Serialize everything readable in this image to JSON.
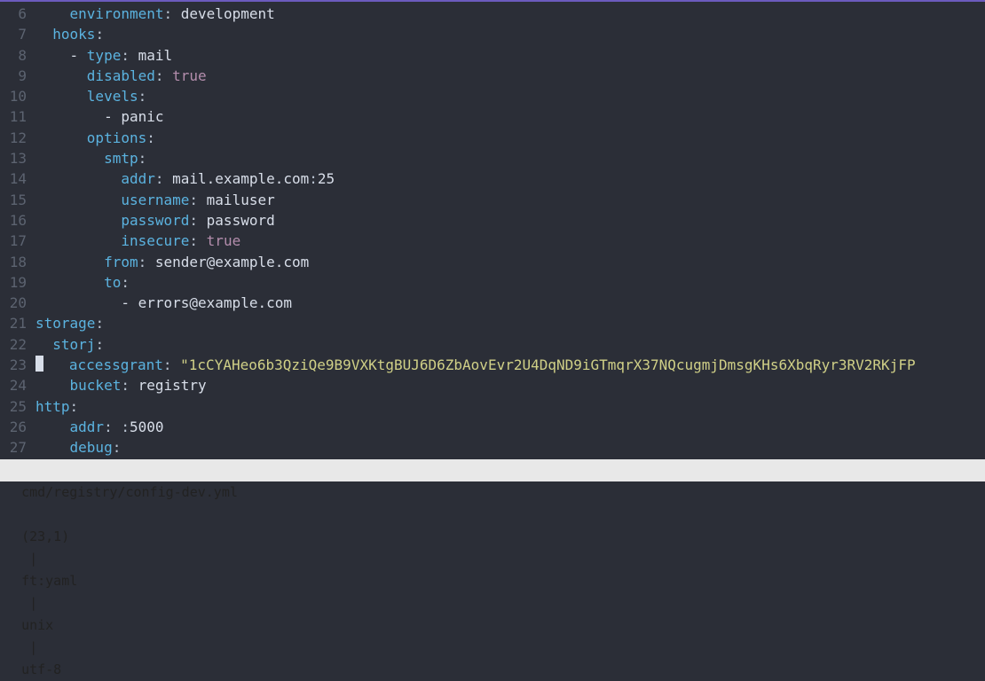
{
  "status": {
    "file": "cmd/registry/config-dev.yml",
    "cursor": "(23,1)",
    "ft": "ft:yaml",
    "nl": "unix",
    "enc": "utf-8",
    "sep": " | "
  },
  "gutter_start": 6,
  "gutter_end": 27,
  "lines": [
    {
      "parts": [
        {
          "t": "    ",
          "c": "lead"
        },
        {
          "t": "environment",
          "c": "blue"
        },
        {
          "t": ":",
          "c": "colon"
        },
        {
          "t": " development",
          "c": "word"
        }
      ]
    },
    {
      "parts": [
        {
          "t": "  ",
          "c": "lead"
        },
        {
          "t": "hooks",
          "c": "blue"
        },
        {
          "t": ":",
          "c": "colon"
        }
      ]
    },
    {
      "parts": [
        {
          "t": "    - ",
          "c": "word"
        },
        {
          "t": "type",
          "c": "blue"
        },
        {
          "t": ":",
          "c": "colon"
        },
        {
          "t": " mail",
          "c": "word"
        }
      ]
    },
    {
      "parts": [
        {
          "t": "      ",
          "c": "lead"
        },
        {
          "t": "disabled",
          "c": "blue"
        },
        {
          "t": ":",
          "c": "colon"
        },
        {
          "t": " ",
          "c": "word"
        },
        {
          "t": "true",
          "c": "purple"
        }
      ]
    },
    {
      "parts": [
        {
          "t": "      ",
          "c": "lead"
        },
        {
          "t": "levels",
          "c": "blue"
        },
        {
          "t": ":",
          "c": "colon"
        }
      ]
    },
    {
      "parts": [
        {
          "t": "        - panic",
          "c": "word"
        }
      ]
    },
    {
      "parts": [
        {
          "t": "      ",
          "c": "lead"
        },
        {
          "t": "options",
          "c": "blue"
        },
        {
          "t": ":",
          "c": "colon"
        }
      ]
    },
    {
      "parts": [
        {
          "t": "        ",
          "c": "lead"
        },
        {
          "t": "smtp",
          "c": "blue"
        },
        {
          "t": ":",
          "c": "colon"
        }
      ]
    },
    {
      "parts": [
        {
          "t": "          ",
          "c": "lead"
        },
        {
          "t": "addr",
          "c": "blue"
        },
        {
          "t": ":",
          "c": "colon"
        },
        {
          "t": " mail.example.com",
          "c": "word"
        },
        {
          "t": ":",
          "c": "colon"
        },
        {
          "t": "25",
          "c": "word"
        }
      ]
    },
    {
      "parts": [
        {
          "t": "          ",
          "c": "lead"
        },
        {
          "t": "username",
          "c": "blue"
        },
        {
          "t": ":",
          "c": "colon"
        },
        {
          "t": " mailuser",
          "c": "word"
        }
      ]
    },
    {
      "parts": [
        {
          "t": "          ",
          "c": "lead"
        },
        {
          "t": "password",
          "c": "blue"
        },
        {
          "t": ":",
          "c": "colon"
        },
        {
          "t": " password",
          "c": "word"
        }
      ]
    },
    {
      "parts": [
        {
          "t": "          ",
          "c": "lead"
        },
        {
          "t": "insecure",
          "c": "blue"
        },
        {
          "t": ":",
          "c": "colon"
        },
        {
          "t": " ",
          "c": "word"
        },
        {
          "t": "true",
          "c": "purple"
        }
      ]
    },
    {
      "parts": [
        {
          "t": "        ",
          "c": "lead"
        },
        {
          "t": "from",
          "c": "blue"
        },
        {
          "t": ":",
          "c": "colon"
        },
        {
          "t": " sender@example.com",
          "c": "word"
        }
      ]
    },
    {
      "parts": [
        {
          "t": "        ",
          "c": "lead"
        },
        {
          "t": "to",
          "c": "blue"
        },
        {
          "t": ":",
          "c": "colon"
        }
      ]
    },
    {
      "parts": [
        {
          "t": "          - errors@example.com",
          "c": "word"
        }
      ]
    },
    {
      "parts": [
        {
          "t": "storage",
          "c": "blue"
        },
        {
          "t": ":",
          "c": "colon"
        }
      ]
    },
    {
      "parts": [
        {
          "t": "  ",
          "c": "lead"
        },
        {
          "t": "storj",
          "c": "blue"
        },
        {
          "t": ":",
          "c": "colon"
        }
      ]
    },
    {
      "cursor": true,
      "parts": [
        {
          "t": "   ",
          "c": "lead"
        },
        {
          "t": "accessgrant",
          "c": "blue"
        },
        {
          "t": ":",
          "c": "colon"
        },
        {
          "t": " ",
          "c": "word"
        },
        {
          "t": "\"1cCYAHeo6b3QziQe9B9VXKtgBUJ6D6ZbAovEvr2U4DqND9iGTmqrX37NQcugmjDmsgKHs6XbqRyr3RV2RKjFP",
          "c": "str"
        }
      ]
    },
    {
      "parts": [
        {
          "t": "    ",
          "c": "lead"
        },
        {
          "t": "bucket",
          "c": "blue"
        },
        {
          "t": ":",
          "c": "colon"
        },
        {
          "t": " registry",
          "c": "word"
        }
      ]
    },
    {
      "parts": [
        {
          "t": "http",
          "c": "blue"
        },
        {
          "t": ":",
          "c": "colon"
        }
      ]
    },
    {
      "parts": [
        {
          "t": "    ",
          "c": "lead"
        },
        {
          "t": "addr",
          "c": "blue"
        },
        {
          "t": ":",
          "c": "colon"
        },
        {
          "t": " ",
          "c": "word"
        },
        {
          "t": ":",
          "c": "colon"
        },
        {
          "t": "5000",
          "c": "word"
        }
      ]
    },
    {
      "parts": [
        {
          "t": "    ",
          "c": "lead"
        },
        {
          "t": "debug",
          "c": "blue"
        },
        {
          "t": ":",
          "c": "colon"
        }
      ]
    }
  ]
}
